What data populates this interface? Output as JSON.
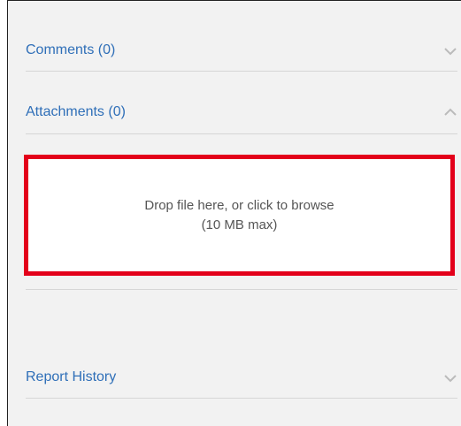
{
  "sections": {
    "comments": {
      "label": "Comments (0)",
      "expanded": false
    },
    "attachments": {
      "label": "Attachments (0)",
      "expanded": true
    },
    "report_history": {
      "label": "Report History",
      "expanded": false
    }
  },
  "dropzone": {
    "line1": "Drop file here, or click to browse",
    "line2": "(10 MB max)"
  },
  "colors": {
    "link": "#2f6fb8",
    "highlight": "#e3001a",
    "chevron": "#bbbbbb",
    "background": "#f2f2f2"
  },
  "icons": {
    "comments": "chevron-down-icon",
    "attachments": "chevron-up-icon",
    "report_history": "chevron-down-icon"
  }
}
